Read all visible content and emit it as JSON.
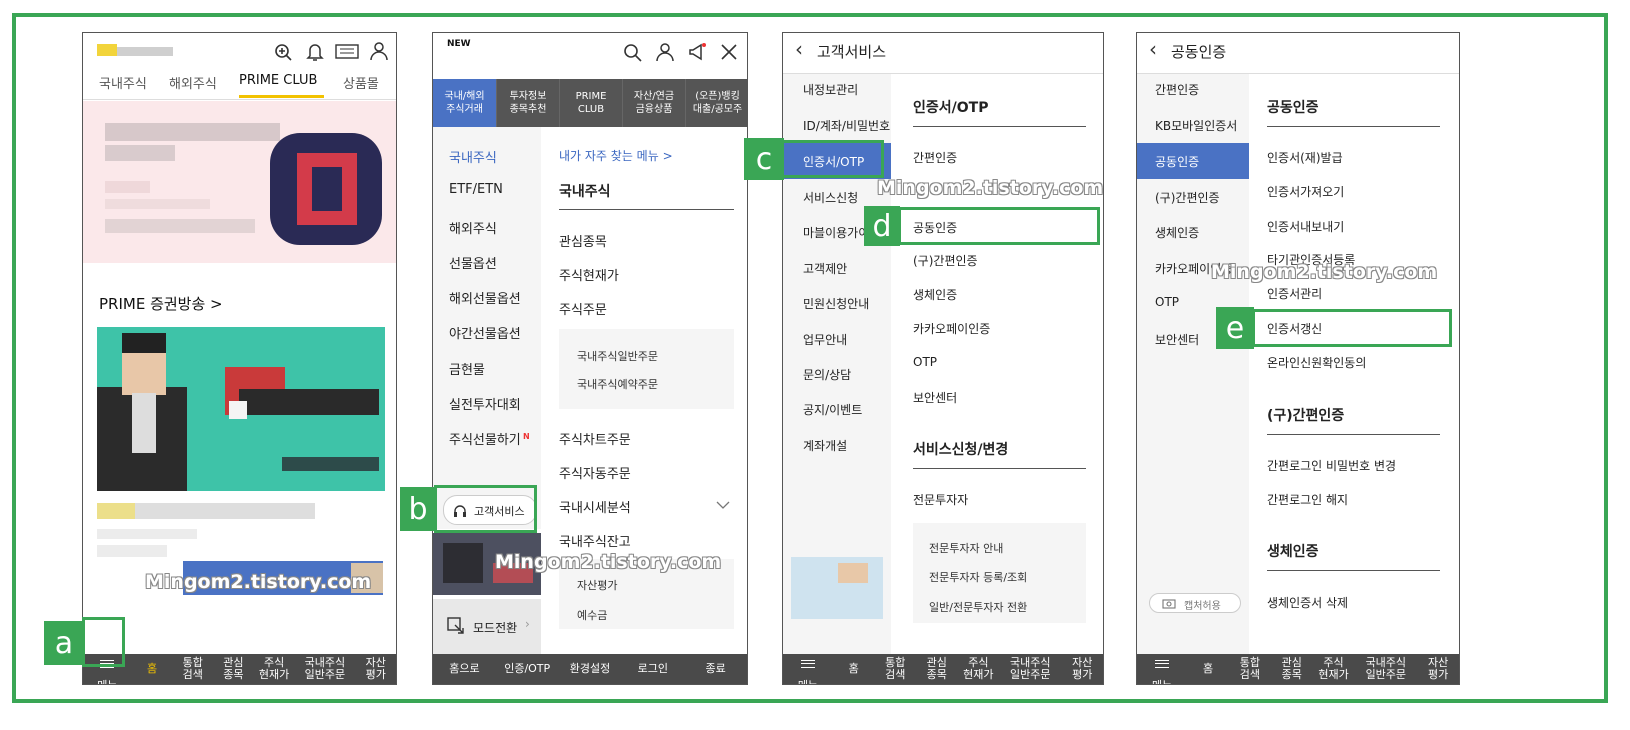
{
  "colors": {
    "frame_green": "#3aa655",
    "nav_blue": "#4a72c4",
    "dark_bar": "#4a4a4a",
    "link_blue": "#3a66c0"
  },
  "p1": {
    "tabs": [
      "국내주식",
      "해외주식",
      "PRIME CLUB",
      "상품몰"
    ],
    "section_title": "PRIME 증권방송 >",
    "watermark": "Mingom2.tistory.com",
    "bottom": [
      "메뉴",
      "홈",
      "통합\n검색",
      "관심\n종목",
      "주식\n현재가",
      "국내주식\n일반주문",
      "자산\n평가"
    ]
  },
  "p2": {
    "new_badge": "NEW",
    "top_tabs": [
      "국내/해외\n주식거래",
      "투자정보\n종목추천",
      "PRIME\nCLUB",
      "자산/연금\n금융상품",
      "(오픈)뱅킹\n대출/공모주"
    ],
    "left_menu": [
      "국내주식",
      "ETF/ETN",
      "해외주식",
      "선물옵션",
      "해외선물옵션",
      "야간선물옵션",
      "금현물",
      "실전투자대회",
      "주식선물하기"
    ],
    "new_mark": "N",
    "freq_link": "내가 자주 찾는 메뉴 >",
    "section": "국내주식",
    "items": [
      "관심종목",
      "주식현재가",
      "주식주문"
    ],
    "sub_items": [
      "국내주식일반주문",
      "국내주식예약주문"
    ],
    "items2": [
      "주식차트주문",
      "주식자동주문",
      "국내시세분석",
      "국내주식잔고"
    ],
    "sub_items2": [
      "자산평가",
      "예수금"
    ],
    "customer_service": "고객서비스",
    "mode_switch": "모드전환",
    "watermark": "Mingom2.tistory.com",
    "bottom": [
      "홈으로",
      "인증/OTP",
      "환경설정",
      "로그인",
      "종료"
    ]
  },
  "p3": {
    "header": "고객서비스",
    "left_menu": [
      "내정보관리",
      "ID/계좌/비밀번호",
      "인증서/OTP",
      "서비스신청",
      "마블이용가이",
      "고객제안",
      "민원신청안내",
      "업무안내",
      "문의/상담",
      "공지/이벤트",
      "계좌개설"
    ],
    "section1": "인증서/OTP",
    "items1": [
      "간편인증",
      "",
      "공동인증",
      "(구)간편인증",
      "생체인증",
      "카카오페이인증",
      "OTP",
      "보안센터"
    ],
    "section2": "서비스신청/변경",
    "items2": [
      "전문투자자"
    ],
    "sub_items": [
      "전문투자자 안내",
      "전문투자자 등록/조회",
      "일반/전문투자자 전환"
    ],
    "watermark": "Mingom2.tistory.com",
    "bottom": [
      "메뉴",
      "홈",
      "통합\n검색",
      "관심\n종목",
      "주식\n현재가",
      "국내주식\n일반주문",
      "자산\n평가"
    ]
  },
  "p4": {
    "header": "공동인증",
    "left_menu": [
      "간편인증",
      "KB모바일인증서",
      "공동인증",
      "(구)간편인증",
      "생체인증",
      "카카오페이인증",
      "OTP",
      "보안센터"
    ],
    "section1": "공동인증",
    "items1": [
      "인증서(재)발급",
      "인증서가져오기",
      "인증서내보내기",
      "타기관인증서등록",
      "인증서관리",
      "인증서갱신",
      "온라인신원확인동의"
    ],
    "section2": "(구)간편인증",
    "items2": [
      "간편로그인 비밀번호 변경",
      "간편로그인 해지"
    ],
    "section3": "생체인증",
    "items3": [
      "생체인증서 삭제"
    ],
    "capture": "캡처허용",
    "watermark": "Mingom2.tistory.com",
    "bottom": [
      "메뉴",
      "홈",
      "통합\n검색",
      "관심\n종목",
      "주식\n현재가",
      "국내주식\n일반주문",
      "자산\n평가"
    ]
  },
  "labels": [
    "a",
    "b",
    "c",
    "d",
    "e"
  ]
}
